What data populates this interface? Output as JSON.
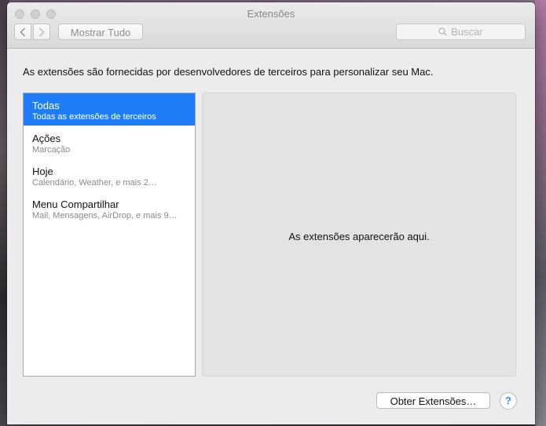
{
  "window": {
    "title": "Extensões"
  },
  "toolbar": {
    "show_all_label": "Mostrar Tudo",
    "search_placeholder": "Buscar"
  },
  "description": "As extensões são fornecidas por desenvolvedores de terceiros para personalizar seu Mac.",
  "sidebar": {
    "items": [
      {
        "title": "Todas",
        "subtitle": "Todas as extensões de terceiros",
        "selected": true
      },
      {
        "title": "Ações",
        "subtitle": "Marcação",
        "selected": false
      },
      {
        "title": "Hoje",
        "subtitle": "Calendário, Weather, e mais 2…",
        "selected": false
      },
      {
        "title": "Menu Compartilhar",
        "subtitle": "Mail, Mensagens, AirDrop, e mais 9…",
        "selected": false
      }
    ]
  },
  "detail": {
    "message": "As extensões aparecerão aqui."
  },
  "footer": {
    "get_extensions_label": "Obter Extensões…",
    "help_label": "?"
  },
  "colors": {
    "selection": "#1e7ef7",
    "help_accent": "#3b86f0"
  }
}
